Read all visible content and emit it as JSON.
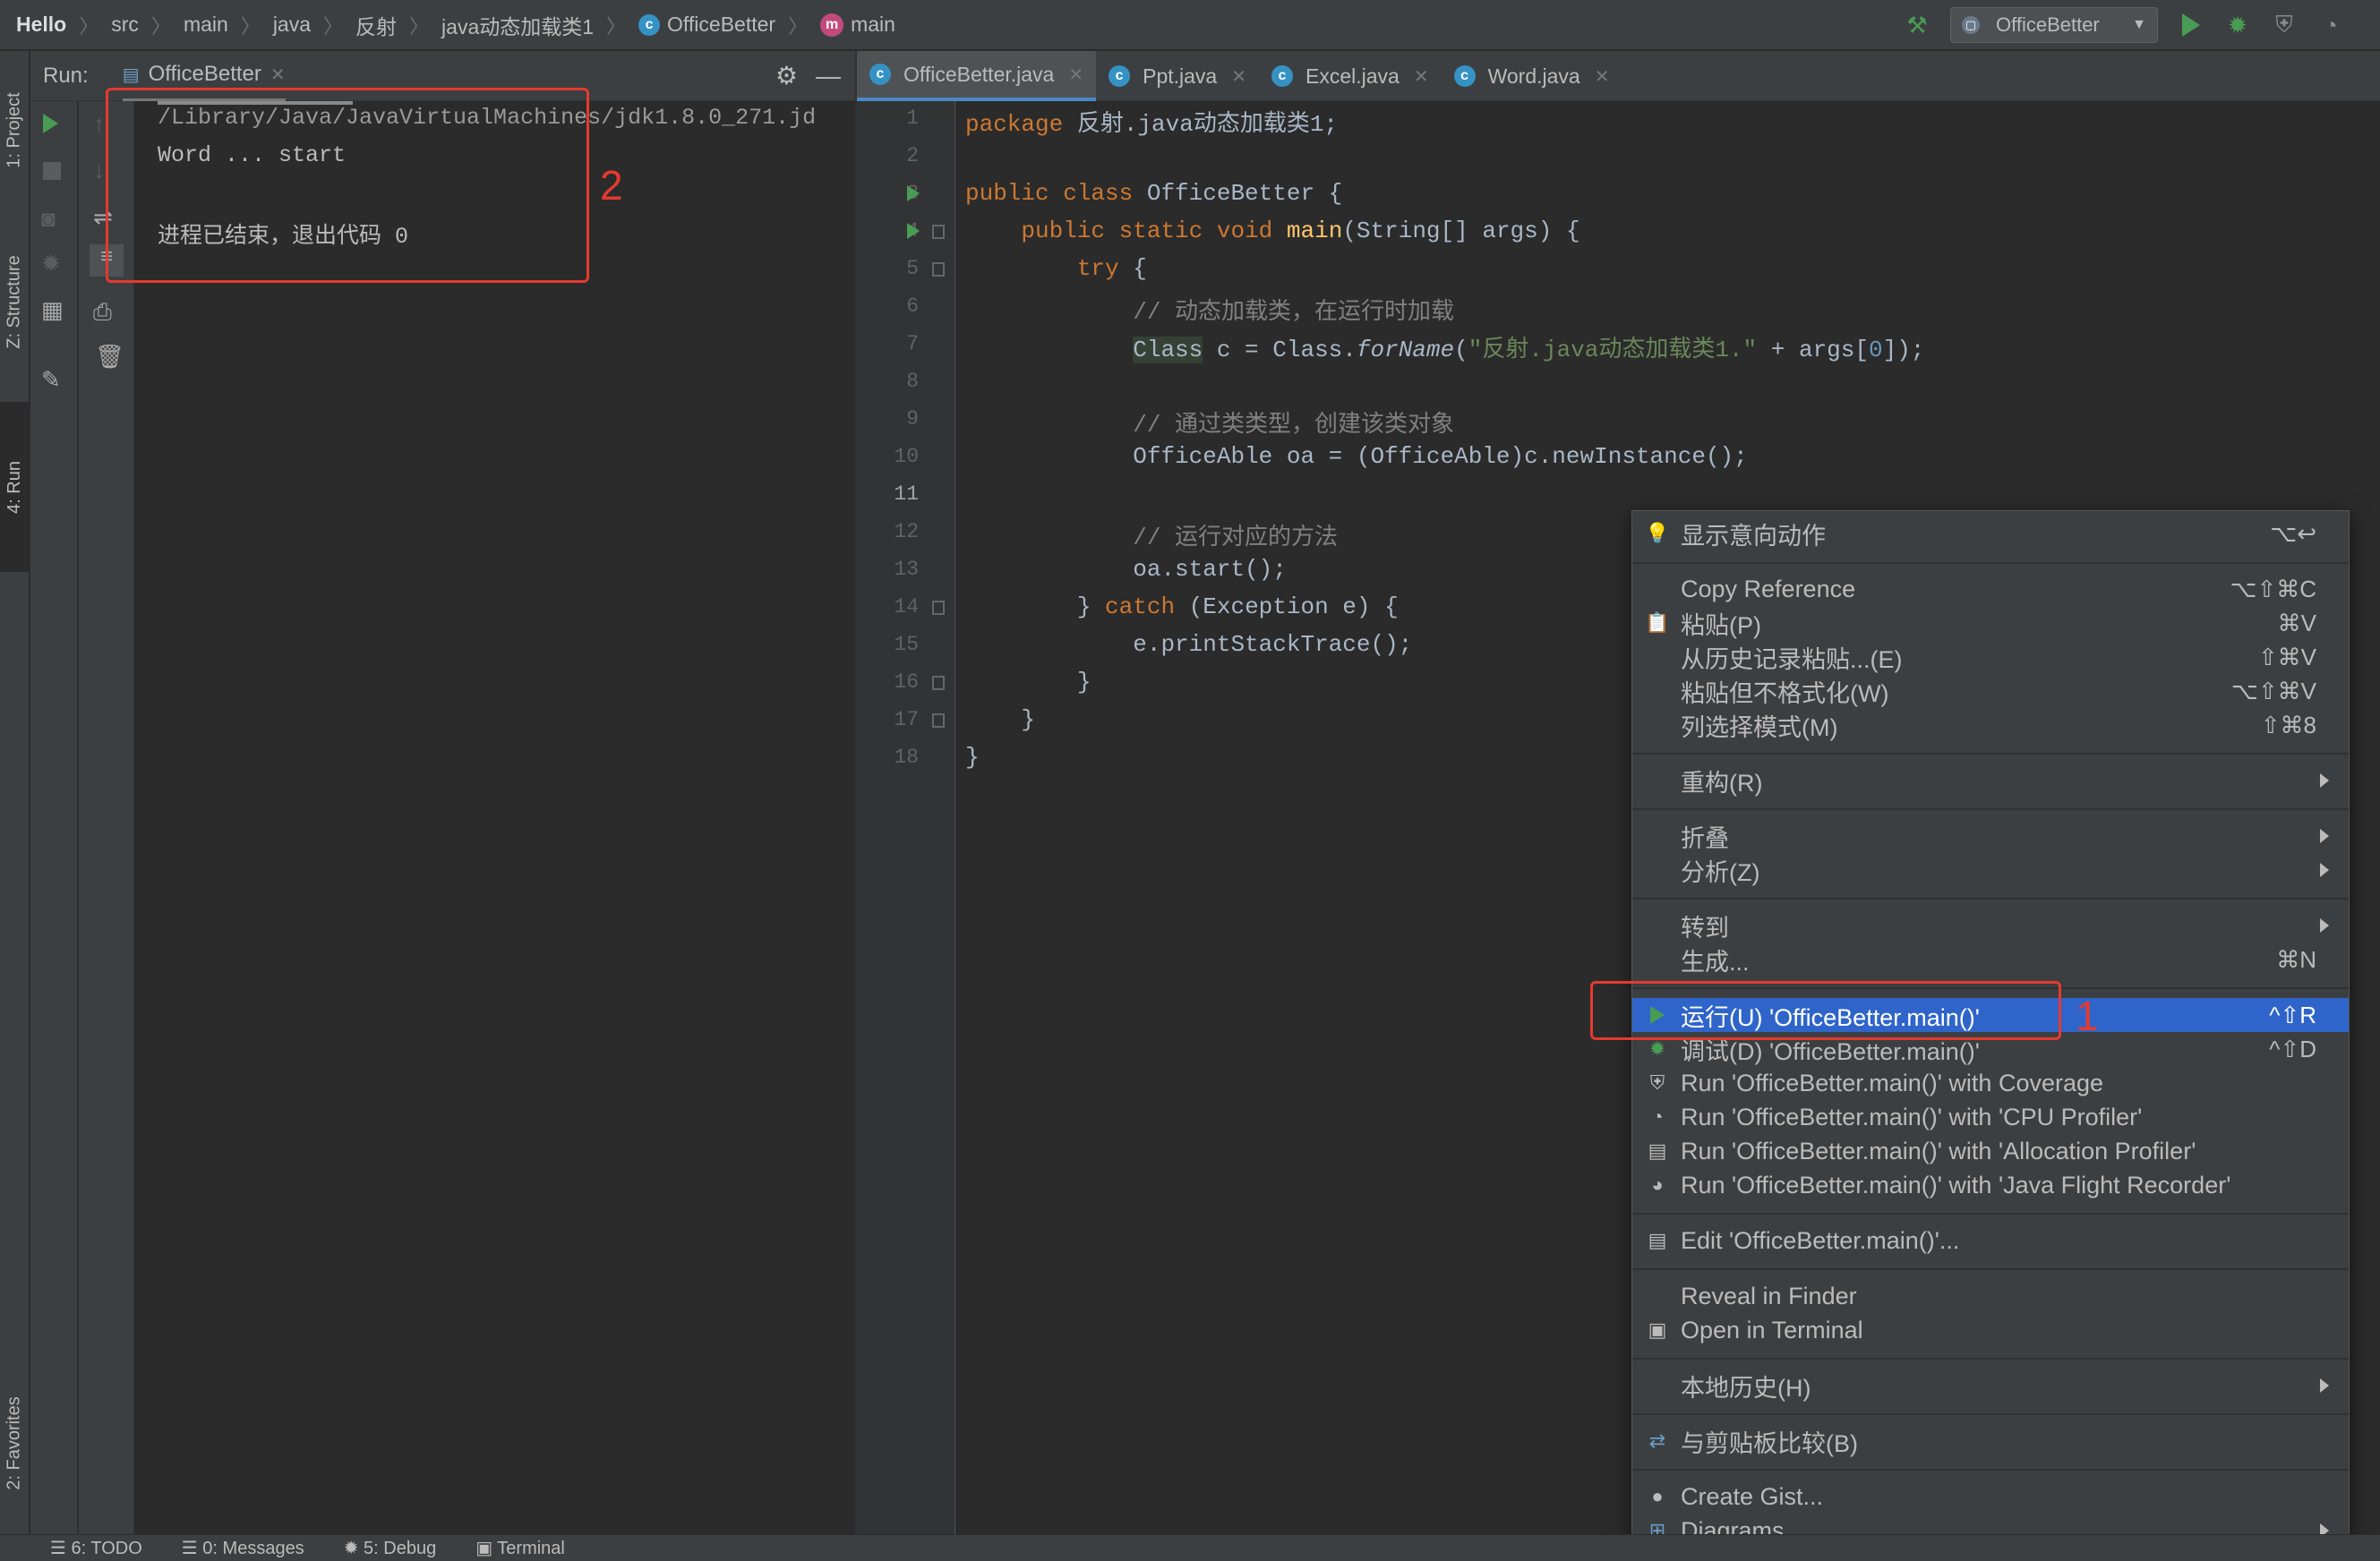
{
  "breadcrumb": [
    "Hello",
    "src",
    "main",
    "java",
    "反射",
    "java动态加载类1",
    "OfficeBetter",
    "main"
  ],
  "toolbar": {
    "run_config": "OfficeBetter"
  },
  "left_tabs": [
    "1: Project",
    "Z: Structure",
    "4: Run",
    "2: Favorites"
  ],
  "run_panel": {
    "label": "Run:",
    "tab": "OfficeBetter"
  },
  "console": {
    "lines": [
      "/Library/Java/JavaVirtualMachines/jdk1.8.0_271.jd",
      "Word ... start",
      "",
      "进程已结束，退出代码 0"
    ]
  },
  "editor_tabs": [
    "OfficeBetter.java",
    "Ppt.java",
    "Excel.java",
    "Word.java"
  ],
  "code": {
    "line_numbers": [
      "1",
      "2",
      "3",
      "4",
      "5",
      "6",
      "7",
      "8",
      "9",
      "10",
      "11",
      "12",
      "13",
      "14",
      "15",
      "16",
      "17",
      "18"
    ],
    "l1_kw": "package",
    "l1_rest": " 反射.java动态加载类1;",
    "l3_kw": "public class",
    "l3_rest": " OfficeBetter {",
    "l4_kw": "public static void",
    "l4_fn": "main",
    "l4_rest": "(String[] args) {",
    "l5_kw": "try",
    "l5_rest": " {",
    "l6": "// 动态加载类，在运行时加载",
    "l7_cls": "Class",
    "l7_a": " c = Class.",
    "l7_fn": "forName",
    "l7_b": "(",
    "l7_str": "\"反射.java动态加载类1.\"",
    "l7_c": " + args[",
    "l7_num": "0",
    "l7_d": "]);",
    "l9": "// 通过类类型，创建该类对象",
    "l10": "OfficeAble oa = (OfficeAble)c.newInstance();",
    "l12": "// 运行对应的方法",
    "l13": "oa.start();",
    "l14_a": "} ",
    "l14_kw": "catch",
    "l14_b": " (Exception e) {",
    "l15": "e.printStackTrace();",
    "l16": "}",
    "l17": "}",
    "l18": "}"
  },
  "context_menu": {
    "show_intentions": "显示意向动作",
    "show_intentions_sc": "⌥↩",
    "copy_reference": "Copy Reference",
    "copy_reference_sc": "⌥⇧⌘C",
    "paste": "粘贴(P)",
    "paste_sc": "⌘V",
    "paste_history": "从历史记录粘贴...(E)",
    "paste_history_sc": "⇧⌘V",
    "paste_plain": "粘贴但不格式化(W)",
    "paste_plain_sc": "⌥⇧⌘V",
    "column_mode": "列选择模式(M)",
    "column_mode_sc": "⇧⌘8",
    "refactor": "重构(R)",
    "folding": "折叠",
    "analyze": "分析(Z)",
    "goto": "转到",
    "generate": "生成...",
    "generate_sc": "⌘N",
    "run": "运行(U) 'OfficeBetter.main()'",
    "run_sc": "^⇧R",
    "debug": "调试(D) 'OfficeBetter.main()'",
    "debug_sc": "^⇧D",
    "run_coverage": "Run 'OfficeBetter.main()' with Coverage",
    "run_cpu": "Run 'OfficeBetter.main()' with 'CPU Profiler'",
    "run_alloc": "Run 'OfficeBetter.main()' with 'Allocation Profiler'",
    "run_jfr": "Run 'OfficeBetter.main()' with 'Java Flight Recorder'",
    "edit_config": "Edit 'OfficeBetter.main()'...",
    "reveal_finder": "Reveal in Finder",
    "open_terminal": "Open in Terminal",
    "local_history": "本地历史(H)",
    "compare_clipboard": "与剪贴板比较(B)",
    "create_gist": "Create Gist...",
    "diagrams": "Diagrams"
  },
  "annotations": {
    "one": "1",
    "two": "2",
    "color": "#e53a2f"
  },
  "bottom_tabs": [
    "6: TODO",
    "0: Messages",
    "5: Debug",
    "Terminal"
  ]
}
